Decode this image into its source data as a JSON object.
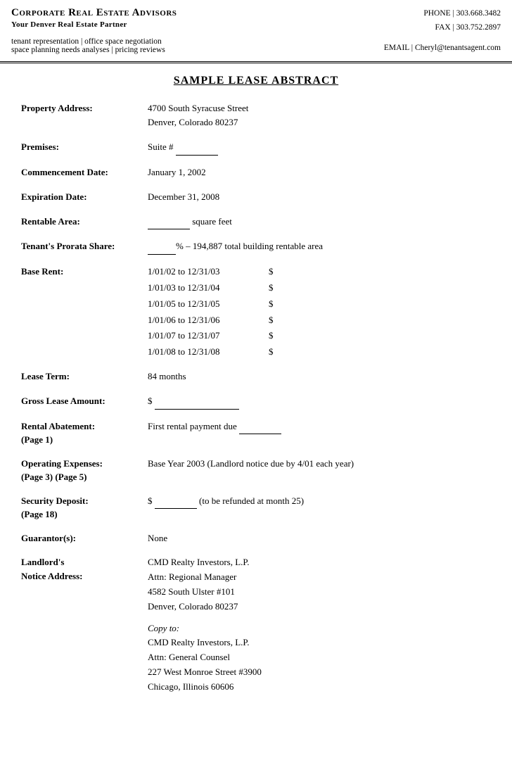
{
  "header": {
    "company_name": "Corporate Real Estate Advisors",
    "tagline": "Your Denver Real Estate Partner",
    "services_line1": "tenant representation  |  office space negotiation",
    "services_line2": "space planning needs analyses  |  pricing reviews",
    "phone_label": "PHONE",
    "phone_number": "303.668.3482",
    "fax_label": "FAX",
    "fax_number": "303.752.2897",
    "email_label": "EMAIL",
    "email_address": "Cheryl@tenantsagent.com"
  },
  "document": {
    "title": "SAMPLE LEASE ABSTRACT",
    "fields": [
      {
        "label": "Property Address:",
        "value_lines": [
          "4700 South Syracuse Street",
          "Denver, Colorado 80237"
        ]
      },
      {
        "label": "Premises:",
        "value_lines": [
          "Suite # _____"
        ]
      },
      {
        "label": "Commencement Date:",
        "value_lines": [
          "January 1, 2002"
        ]
      },
      {
        "label": "Expiration Date:",
        "value_lines": [
          "December 31, 2008"
        ]
      },
      {
        "label": "Rentable Area:",
        "value_lines": [
          "_______ square feet"
        ]
      },
      {
        "label": "Tenant's Prorata Share:",
        "value_lines": [
          "______% – 194,887 total building rentable area"
        ]
      },
      {
        "label": "Base Rent:",
        "rent_rows": [
          "1/01/02 to 12/31/03",
          "1/01/03 to 12/31/04",
          "1/01/05 to 12/31/05",
          "1/01/06 to 12/31/06",
          "1/01/07 to 12/31/07",
          "1/01/08 to 12/31/08"
        ]
      },
      {
        "label": "Lease Term:",
        "value_lines": [
          "84 months"
        ]
      },
      {
        "label": "Gross Lease Amount:",
        "value_lines": [
          "$  _______________"
        ]
      },
      {
        "label": "Rental Abatement:\n(Page 1)",
        "label_line1": "Rental Abatement:",
        "label_line2": "(Page 1)",
        "value_lines": [
          "First rental payment due _________"
        ]
      },
      {
        "label_line1": "Operating Expenses:",
        "label_line2": "(Page 3) (Page 5)",
        "value_lines": [
          "Base Year 2003 (Landlord notice due by 4/01 each year)"
        ]
      },
      {
        "label_line1": "Security Deposit:",
        "label_line2": "(Page 18)",
        "value_lines": [
          "$  ________  (to be refunded at month 25)"
        ]
      },
      {
        "label": "Guarantor(s):",
        "value_lines": [
          "None"
        ]
      },
      {
        "label_line1": "Landlord's",
        "label_line2": "Notice Address:",
        "value_lines": [
          "CMD Realty Investors, L.P.",
          "Attn: Regional Manager",
          "4582 South Ulster #101",
          "Denver, Colorado 80237",
          "",
          "Copy to:",
          "CMD Realty Investors, L.P.",
          "Attn: General Counsel",
          "227 West Monroe Street #3900",
          "Chicago, Illinois 60606"
        ],
        "copy_to_italic": true
      }
    ]
  }
}
